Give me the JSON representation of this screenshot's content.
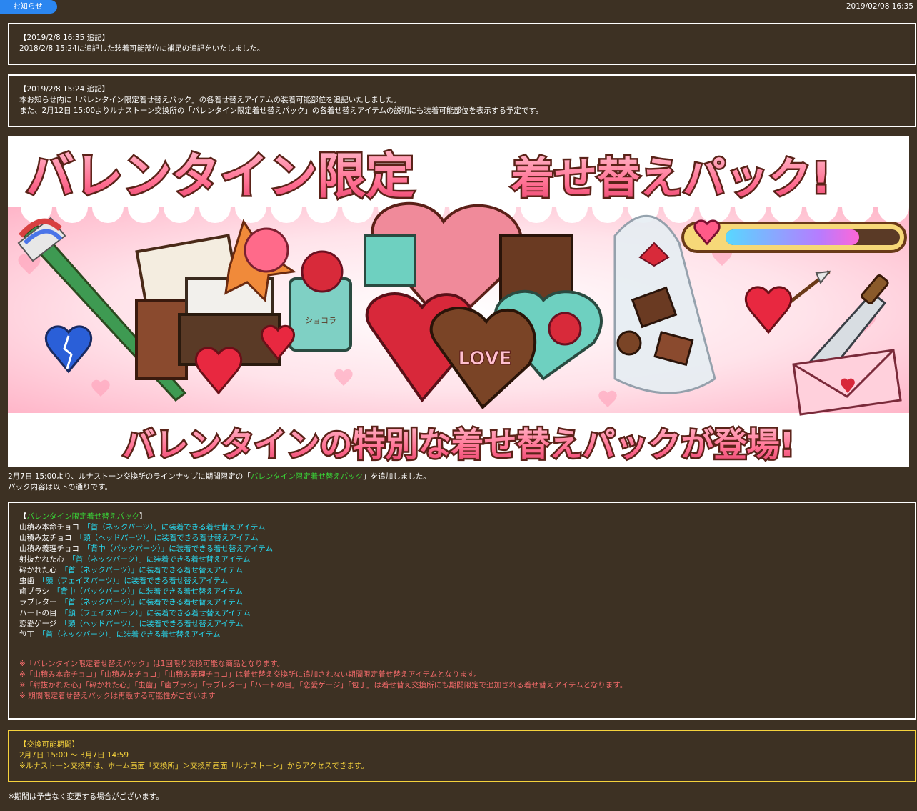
{
  "header": {
    "tag_label": "お知らせ",
    "date": "2019/02/08 16:35"
  },
  "update1": {
    "title": "【2019/2/8 16:35 追記】",
    "line1": "2018/2/8 15:24に追記した装着可能部位に補足の追記をいたしました。"
  },
  "update2": {
    "title": "【2019/2/8 15:24 追記】",
    "line1": "本お知らせ内に「バレンタイン限定着せ替えパック」の各着せ替えアイテムの装着可能部位を追記いたしました。",
    "line2": "また、2月12日 15:00よりルナストーン交換所の「バレンタイン限定着せ替えパック」の各着せ替えアイテムの説明にも装着可能部位を表示する予定です。"
  },
  "banner": {
    "title_left": "バレンタイン限定",
    "title_right": "着せ替えパック!",
    "subtitle": "バレンタインの特別な着せ替えパックが登場!",
    "heart_box_text": "LOVE",
    "can_label": "ショコラ",
    "colors": {
      "bg_pink": "#ffc9d8",
      "title_fill": "#ff7a9a",
      "title_stroke": "#6a2a1e",
      "chocolate": "#6b3b22",
      "teal": "#5ec6b6",
      "red": "#d8283a"
    }
  },
  "intro": {
    "line1_prefix": "2月7日 15:00より、ルナストーン交換所のラインナップに期間限定の「",
    "line1_highlight": "バレンタイン限定着せ替えパック",
    "line1_suffix": "」を追加しました。",
    "line2": "パック内容は以下の通りです。"
  },
  "pack": {
    "open_bracket": "【",
    "title": "バレンタイン限定着せ替えパック",
    "close_bracket": "】",
    "items": [
      {
        "name": "山積み本命チョコ",
        "part": "「首（ネックパーツ）」に装着できる着せ替えアイテム"
      },
      {
        "name": "山積み友チョコ",
        "part": "「頭（ヘッドパーツ）」に装着できる着せ替えアイテム"
      },
      {
        "name": "山積み義理チョコ",
        "part": "「背中（バックパーツ）」に装着できる着せ替えアイテム"
      },
      {
        "name": "射抜かれた心",
        "part": "「首（ネックパーツ）」に装着できる着せ替えアイテム"
      },
      {
        "name": "砕かれた心",
        "part": "「首（ネックパーツ）」に装着できる着せ替えアイテム"
      },
      {
        "name": "虫歯",
        "part": "「顔（フェイスパーツ）」に装着できる着せ替えアイテム"
      },
      {
        "name": "歯ブラシ",
        "part": "「背中（バックパーツ）」に装着できる着せ替えアイテム"
      },
      {
        "name": "ラブレター",
        "part": "「首（ネックパーツ）」に装着できる着せ替えアイテム"
      },
      {
        "name": "ハートの目",
        "part": "「顔（フェイスパーツ）」に装着できる着せ替えアイテム"
      },
      {
        "name": "恋愛ゲージ",
        "part": "「頭（ヘッドパーツ）」に装着できる着せ替えアイテム"
      },
      {
        "name": "包丁",
        "part": "「首（ネックパーツ）」に装着できる着せ替えアイテム"
      }
    ],
    "notes": [
      "※「バレンタイン限定着せ替えパック」は1回限り交換可能な商品となります。",
      "※「山積み本命チョコ」「山積み友チョコ」「山積み義理チョコ」は着せ替え交換所に追加されない期間限定着せ替えアイテムとなります。",
      "※「射抜かれた心」「砕かれた心」「虫歯」「歯ブラシ」「ラブレター」「ハートの目」「恋愛ゲージ」「包丁」は着せ替え交換所にも期間限定で追加される着せ替えアイテムとなります。",
      "※ 期間限定着せ替えパックは再販する可能性がございます"
    ]
  },
  "period": {
    "title": "【交換可能期間】",
    "range": "2月7日 15:00 ～ 3月7日 14:59",
    "access": "※ルナストーン交換所は、ホーム画面「交換所」＞交換所画面「ルナストーン」からアクセスできます。"
  },
  "footer": {
    "note": "※期間は予告なく変更する場合がございます。"
  }
}
